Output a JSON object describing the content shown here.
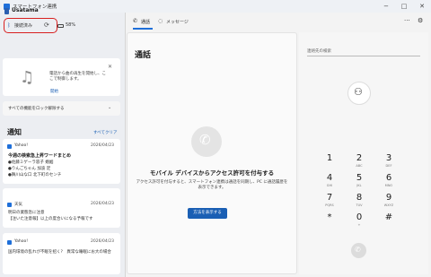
{
  "window": {
    "title": "スマートフォン連携",
    "icon": "app-logo-icon",
    "controls": [
      "−",
      "□",
      "✕"
    ]
  },
  "phone": {
    "name": "Usatama",
    "connection": "接続済み",
    "battery": "58%"
  },
  "promo": {
    "text": "電話から曲の再生を開始し、ここで制御します。",
    "link": "開始"
  },
  "features": {
    "label": "すべての機能をロック解除する"
  },
  "notifications": {
    "title": "通知",
    "clear_all": "すべてクリア",
    "items": [
      {
        "app": "Yahoo!",
        "date": "2026/04/23",
        "title": "今週の検索急上昇ワードまとめ",
        "lines": [
          "●佐藤ミゲーラ容子 婚姻",
          "●りんごちゃん 加波 足",
          "●舞川山な口 北下町のセンチ"
        ]
      },
      {
        "app": "天気",
        "date": "2026/04/23",
        "lines": [
          "明日の業態急に注意",
          "【注いた注意報】以上の度合いになる予報です"
        ]
      },
      {
        "app": "Yahoo!",
        "date": "2026/04/23",
        "lines": [
          "国内環境の乱れが不眠を招く?　異常な睡眠にお大の場合"
        ]
      }
    ]
  },
  "tabs": [
    {
      "label": "通話",
      "icon": "phone-icon",
      "active": true
    },
    {
      "label": "メッセージ",
      "icon": "chat-icon",
      "active": false
    }
  ],
  "calls": {
    "title": "通話",
    "heading": "モバイル デバイスからアクセス許可を付与する",
    "body": "アクセス許可を付与すると、スマートフォン連携は通話を同期し、PC に通話履歴を表示できます。",
    "button": "方法を表示する"
  },
  "dialer": {
    "search_placeholder": "連絡先の検索",
    "keys": [
      {
        "digit": "1",
        "letters": ""
      },
      {
        "digit": "2",
        "letters": "ABC"
      },
      {
        "digit": "3",
        "letters": "DEF"
      },
      {
        "digit": "4",
        "letters": "GHI"
      },
      {
        "digit": "5",
        "letters": "JKL"
      },
      {
        "digit": "6",
        "letters": "MNO"
      },
      {
        "digit": "7",
        "letters": "PQRS"
      },
      {
        "digit": "8",
        "letters": "TUV"
      },
      {
        "digit": "9",
        "letters": "WXYZ"
      },
      {
        "digit": "*",
        "letters": ""
      },
      {
        "digit": "0",
        "letters": "+"
      },
      {
        "digit": "#",
        "letters": ""
      }
    ]
  },
  "colors": {
    "accent": "#1a5fb4",
    "highlight_border": "#d82020"
  }
}
